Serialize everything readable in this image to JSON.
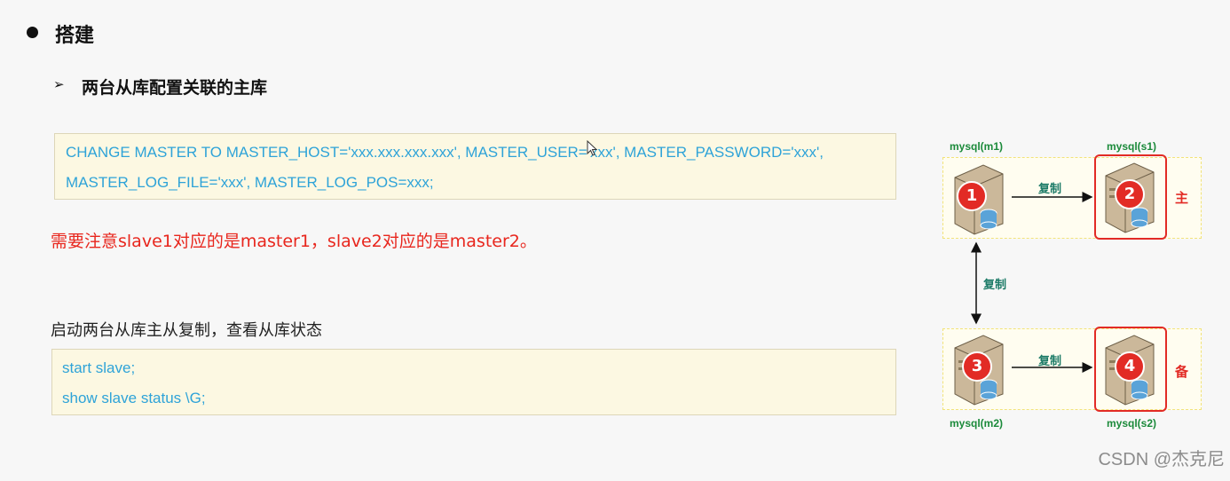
{
  "heading": "搭建",
  "subheading": "两台从库配置关联的主库",
  "code_block_1": {
    "line1": "CHANGE MASTER TO MASTER_HOST='xxx.xxx.xxx.xxx', MASTER_USER='xxx', MASTER_PASSWORD='xxx',",
    "line2": "MASTER_LOG_FILE='xxx', MASTER_LOG_POS=xxx;"
  },
  "note": "需要注意slave1对应的是master1，slave2对应的是master2。",
  "description": "启动两台从库主从复制，查看从库状态",
  "code_block_2": {
    "line1": "start slave;",
    "line2": "show  slave  status \\G;"
  },
  "diagram": {
    "nodes": [
      {
        "number": "1",
        "label": "mysql(m1)"
      },
      {
        "number": "2",
        "label": "mysql(s1)"
      },
      {
        "number": "3",
        "label": "mysql(m2)"
      },
      {
        "number": "4",
        "label": "mysql(s2)"
      }
    ],
    "replicate_label_top": "复制",
    "replicate_label_middle": "复制",
    "replicate_label_bottom": "复制",
    "primary_label": "主",
    "backup_label": "备"
  },
  "watermark": "CSDN @杰克尼",
  "colors": {
    "code_text": "#2ea3d8",
    "note_text": "#e8261d",
    "node_red": "#e22b25",
    "label_green": "#1b8a3a"
  }
}
